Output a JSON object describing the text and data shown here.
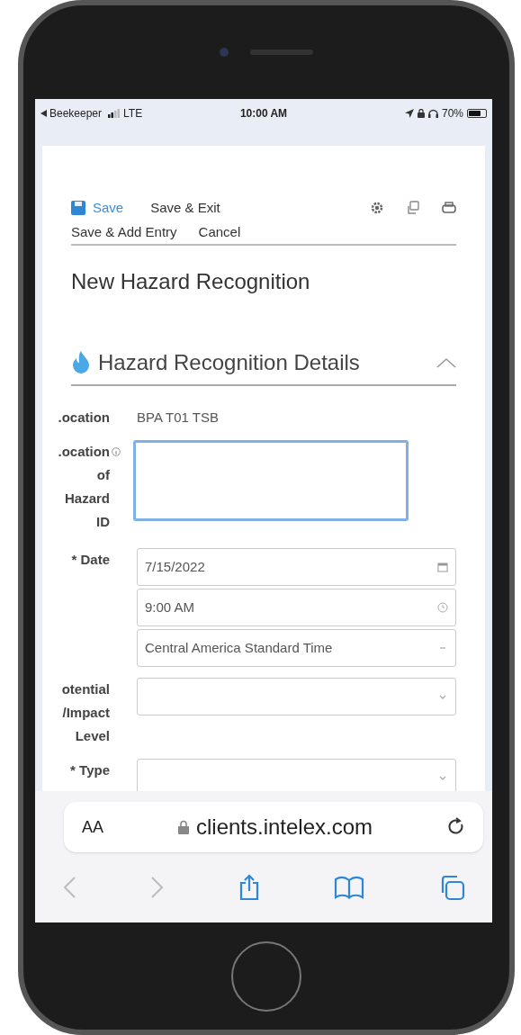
{
  "status_bar": {
    "back_app": "Beekeeper",
    "network": "LTE",
    "time": "10:00 AM",
    "battery": "70%"
  },
  "toolbar": {
    "actions": [
      {
        "label": "Save",
        "kind": "primary"
      },
      {
        "label": "Save & Exit",
        "kind": "link"
      },
      {
        "label": "Save & Add Entry",
        "kind": "link"
      },
      {
        "label": "Cancel",
        "kind": "link"
      }
    ]
  },
  "page_title": "New Hazard Recognition",
  "section": {
    "title": "Hazard Recognition Details",
    "expanded": true
  },
  "fields": [
    {
      "kind": "static",
      "label_lines": [
        ".ocation"
      ],
      "value": "BPA T01 TSB"
    },
    {
      "kind": "textarea",
      "label_lines": [
        ".ocation",
        "of",
        "Hazard",
        "ID"
      ],
      "info": true,
      "focused": true
    },
    {
      "kind": "datetime",
      "label_lines": [
        "* Date"
      ],
      "date": "7/15/2022",
      "time": "9:00 AM",
      "timezone": "Central America Standard Time"
    },
    {
      "kind": "select",
      "label_lines": [
        "otential",
        "/Impact",
        "Level"
      ]
    },
    {
      "kind": "select",
      "label_lines": [
        "* Type"
      ]
    }
  ],
  "browser": {
    "text_size": "AA",
    "url": "clients.intelex.com"
  }
}
